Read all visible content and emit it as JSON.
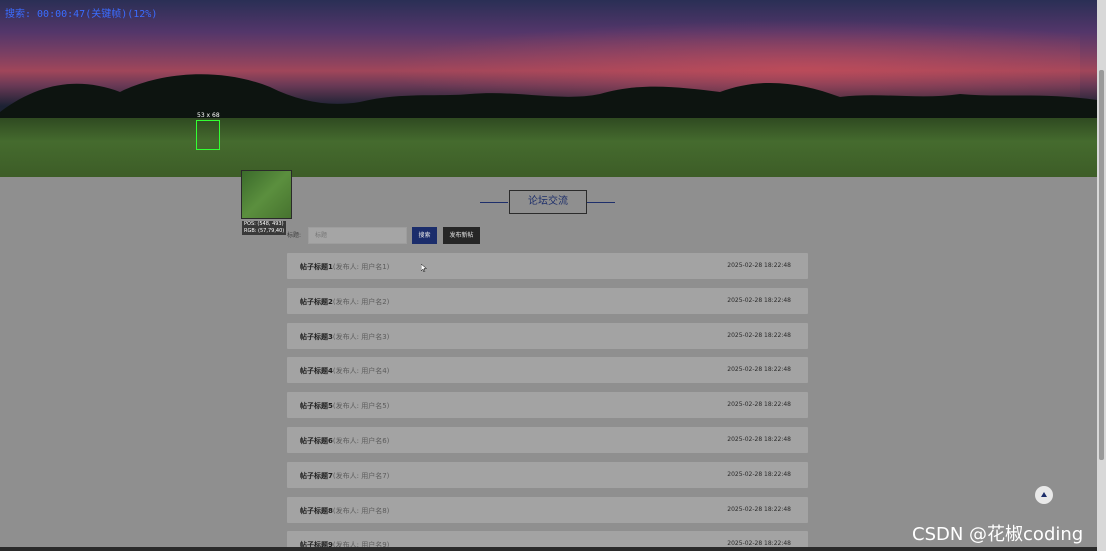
{
  "overlay": {
    "search_status": "搜索: 00:00:47(关键帧)(12%)"
  },
  "picker": {
    "size": "53 x 68",
    "pos": "POS: (548, 493)",
    "rgb": "RGB: (57,79,40)"
  },
  "forum": {
    "title": "论坛交流"
  },
  "search": {
    "label": "标题:",
    "placeholder": "标题",
    "search_button": "搜索",
    "post_button": "发布新帖"
  },
  "posts": [
    {
      "title": "帖子标题1",
      "author": "(发布人: 用户名1)",
      "time": "2025-02-28 18:22:48"
    },
    {
      "title": "帖子标题2",
      "author": "(发布人: 用户名2)",
      "time": "2025-02-28 18:22:48"
    },
    {
      "title": "帖子标题3",
      "author": "(发布人: 用户名3)",
      "time": "2025-02-28 18:22:48"
    },
    {
      "title": "帖子标题4",
      "author": "(发布人: 用户名4)",
      "time": "2025-02-28 18:22:48"
    },
    {
      "title": "帖子标题5",
      "author": "(发布人: 用户名5)",
      "time": "2025-02-28 18:22:48"
    },
    {
      "title": "帖子标题6",
      "author": "(发布人: 用户名6)",
      "time": "2025-02-28 18:22:48"
    },
    {
      "title": "帖子标题7",
      "author": "(发布人: 用户名7)",
      "time": "2025-02-28 18:22:48"
    },
    {
      "title": "帖子标题8",
      "author": "(发布人: 用户名8)",
      "time": "2025-02-28 18:22:48"
    },
    {
      "title": "帖子标题9",
      "author": "(发布人: 用户名9)",
      "time": "2025-02-28 18:22:48"
    }
  ],
  "watermark": "CSDN @花椒coding",
  "icons": {
    "back_to_top": "arrow-up-icon",
    "cursor": "mouse-pointer-icon"
  },
  "colors": {
    "accent": "#1b2d6b",
    "post_button": "#262626",
    "page_background": "#8f8f8f",
    "post_row": "#a3a3a3"
  }
}
